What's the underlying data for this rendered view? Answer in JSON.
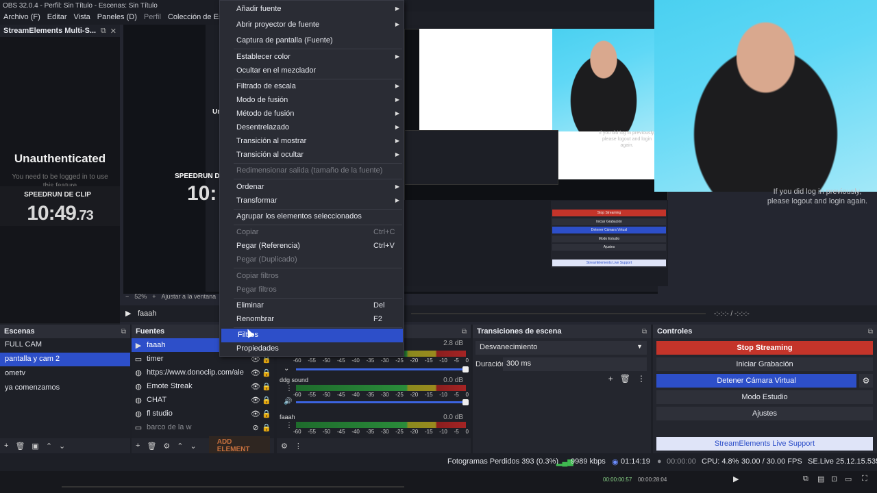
{
  "window": {
    "title": "OBS 32.0.4 - Perfil: Sin Título - Escenas: Sin Título"
  },
  "menubar": [
    "Archivo (F)",
    "Editar",
    "Vista",
    "Paneles (D)",
    "Perfil",
    "Colección de Escenas"
  ],
  "se_dock": {
    "title": "StreamElements Multi-S...",
    "unauth_title": "Unauthenticated",
    "unauth_sub": "You need to be logged in to use this feature",
    "speedrun_label": "SPEEDRUN DE CLIP",
    "speedrun_time_main": "10:49",
    "speedrun_time_frac": ".73"
  },
  "preview": {
    "mini_speedrun": "SPEEDRUN D",
    "mini_time": "10:",
    "mini_unauth": "Un",
    "right_text": "If you did log in previously, please logout and login again.",
    "zoom": "52%",
    "zoom_fit": "Ajustar a la ventana",
    "media_name": "faaah",
    "media_time": "-:-:-:-  /  -:-:-:-",
    "nested": {
      "stop": "Stop Streaming",
      "rec": "Iniciar Grabación",
      "vcam": "Detener Cámara Virtual",
      "studio": "Modo Estudio",
      "settings": "Ajustes",
      "support": "StreamElements Live Support"
    }
  },
  "context_menu": {
    "items": [
      {
        "label": "Añadir fuente",
        "submenu": true
      },
      {
        "label": "Abrir proyector de fuente",
        "submenu": true
      },
      {
        "label": "Captura de pantalla (Fuente)"
      },
      {
        "label": "Establecer color",
        "submenu": true
      },
      {
        "label": "Ocultar en el mezclador"
      },
      {
        "label": "Filtrado de escala",
        "submenu": true
      },
      {
        "label": "Modo de fusión",
        "submenu": true
      },
      {
        "label": "Método de fusión",
        "submenu": true
      },
      {
        "label": "Desentrelazado",
        "submenu": true
      },
      {
        "label": "Transición al mostrar",
        "submenu": true
      },
      {
        "label": "Transición al ocultar",
        "submenu": true
      },
      {
        "label": "Redimensionar salida (tamaño de la fuente)",
        "disabled": true
      },
      {
        "label": "Ordenar",
        "submenu": true
      },
      {
        "label": "Transformar",
        "submenu": true
      },
      {
        "label": "Agrupar los elementos seleccionados"
      },
      {
        "label": "Copiar",
        "shortcut": "Ctrl+C",
        "disabled": true
      },
      {
        "label": "Pegar (Referencia)",
        "shortcut": "Ctrl+V"
      },
      {
        "label": "Pegar (Duplicado)",
        "disabled": true
      },
      {
        "label": "Copiar filtros",
        "disabled": true
      },
      {
        "label": "Pegar filtros",
        "disabled": true
      },
      {
        "label": "Eliminar",
        "shortcut": "Del"
      },
      {
        "label": "Renombrar",
        "shortcut": "F2"
      },
      {
        "label": "Filtros",
        "highlighted": true
      },
      {
        "label": "Propiedades"
      }
    ]
  },
  "scenes": {
    "title": "Escenas",
    "items": [
      {
        "label": "FULL CAM"
      },
      {
        "label": "pantalla y cam 2",
        "selected": true
      },
      {
        "label": "ometv"
      },
      {
        "label": "ya comenzamos"
      }
    ]
  },
  "sources": {
    "title": "Fuentes",
    "add_element": "ADD ELEMENT",
    "items": [
      {
        "label": "faaah",
        "icon": "play-icon",
        "selected": true
      },
      {
        "label": "timer",
        "icon": "window-icon"
      },
      {
        "label": "https://www.donoclip.com/ale",
        "icon": "globe-icon"
      },
      {
        "label": "Emote Streak",
        "icon": "globe-icon"
      },
      {
        "label": "CHAT",
        "icon": "globe-icon"
      },
      {
        "label": "fl studio",
        "icon": "globe-icon"
      },
      {
        "label": "barco de la w",
        "icon": "window-icon",
        "hidden": true
      }
    ]
  },
  "mixer": {
    "channels": [
      {
        "name": "",
        "db": "2.8 dB"
      },
      {
        "name": "ddg sound",
        "db": "0.0 dB"
      },
      {
        "name": "faaah",
        "db": "0.0 dB"
      }
    ],
    "scale": [
      "-60",
      "-55",
      "-50",
      "-45",
      "-40",
      "-35",
      "-30",
      "-25",
      "-20",
      "-15",
      "-10",
      "-5",
      "0"
    ]
  },
  "transitions": {
    "title": "Transiciones de escena",
    "selected": "Desvanecimiento",
    "duration_label": "Duración",
    "duration": "300 ms"
  },
  "controls": {
    "title": "Controles",
    "stop_streaming": "Stop Streaming",
    "start_recording": "Iniciar Grabación",
    "stop_vcam": "Detener Cámara Virtual",
    "studio_mode": "Modo Estudio",
    "settings": "Ajustes",
    "support": "StreamElements Live Support"
  },
  "status": {
    "dropped": "Fotogramas Perdidos 393 (0.3%)",
    "bitrate": "9989 kbps",
    "stream_time": "01:14:19",
    "rec_time": "00:00:00",
    "cpu": "CPU: 4.8%",
    "fps": "30.00 / 30.00 FPS",
    "se_version": "SE.Live 25.12.15.535"
  },
  "bottom": {
    "time_a": "00:00:00:57",
    "time_b": "00:00:28:04"
  }
}
